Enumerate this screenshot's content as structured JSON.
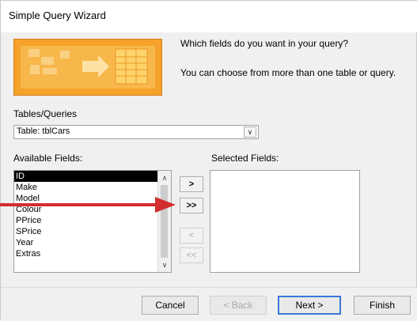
{
  "window": {
    "title": "Simple Query Wizard"
  },
  "intro": {
    "question": "Which fields do you want in your query?",
    "hint": "You can choose from more than one table or query."
  },
  "tables": {
    "label": "Tables/Queries",
    "selected": "Table: tblCars"
  },
  "available": {
    "label": "Available Fields:",
    "items": [
      "ID",
      "Make",
      "Model",
      "Colour",
      "PPrice",
      "SPrice",
      "Year",
      "Extras"
    ],
    "selected_index": 0
  },
  "selected_fields": {
    "label": "Selected Fields:",
    "items": []
  },
  "move_buttons": {
    "add_one": ">",
    "add_all": ">>",
    "remove_one": "<",
    "remove_all": "<<"
  },
  "footer": {
    "cancel": "Cancel",
    "back": "< Back",
    "next": "Next >",
    "finish": "Finish"
  },
  "colors": {
    "annotation_arrow": "#d22e2e",
    "banner": "#f6a12a"
  }
}
